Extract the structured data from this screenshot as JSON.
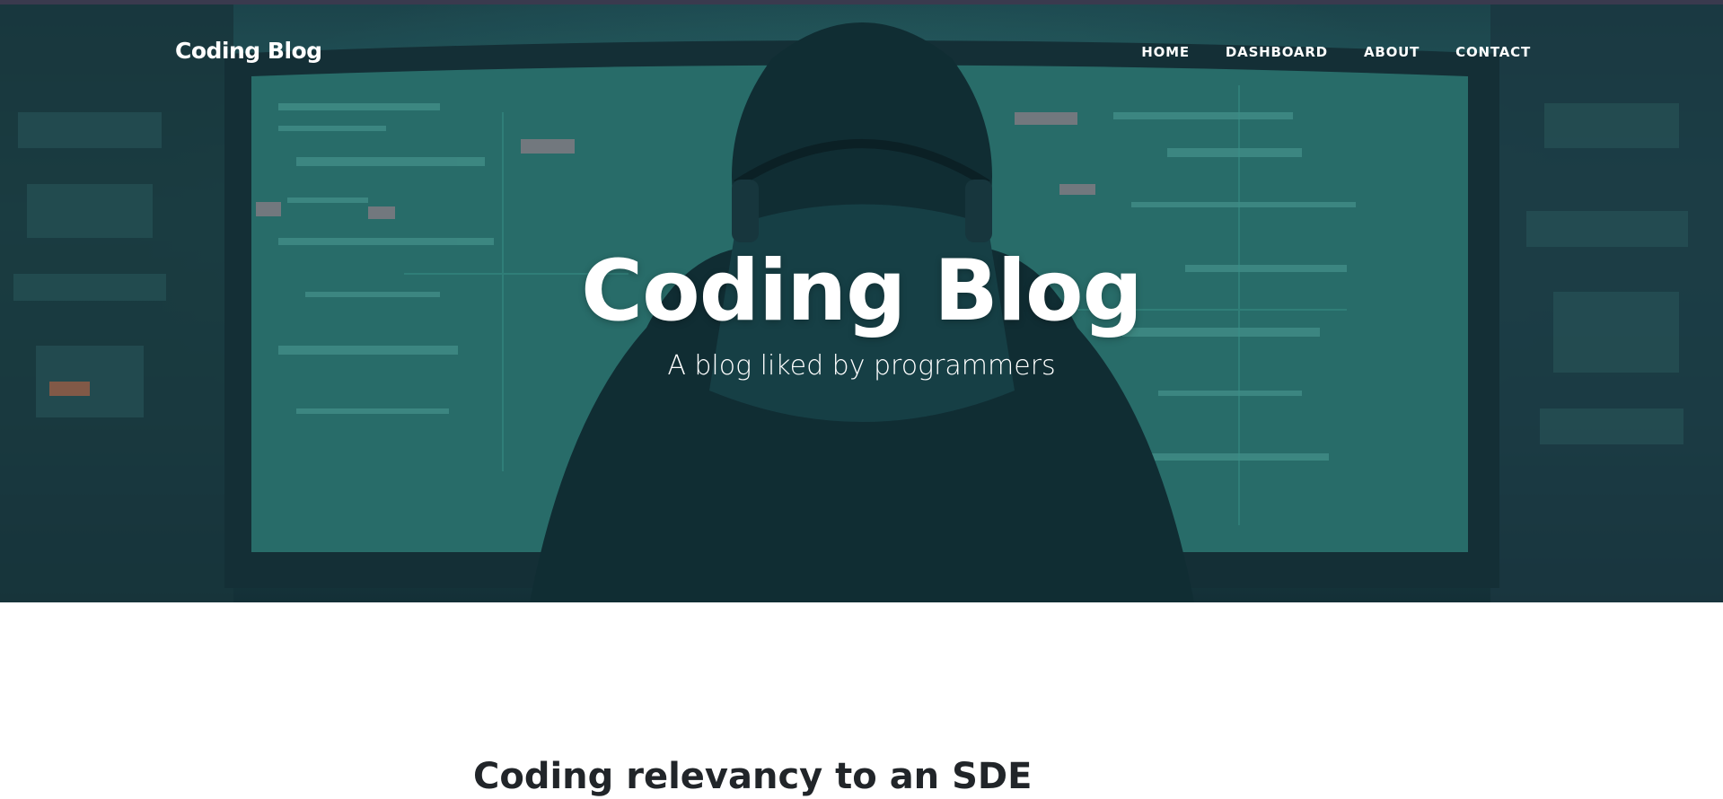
{
  "navbar": {
    "brand": "Coding Blog",
    "links": [
      {
        "label": "HOME"
      },
      {
        "label": "DASHBOARD"
      },
      {
        "label": "ABOUT"
      },
      {
        "label": "CONTACT"
      }
    ]
  },
  "hero": {
    "title": "Coding Blog",
    "subtitle": "A blog liked by programmers",
    "background_image_alt": "programmer with headphones facing a wall of teal code screens"
  },
  "posts": [
    {
      "title": "Coding relevancy to an SDE"
    }
  ],
  "colors": {
    "hero_teal": "#2a6b6c",
    "hero_dark": "#15333a",
    "text_dark": "#212529",
    "nav_text": "#ffffff"
  }
}
